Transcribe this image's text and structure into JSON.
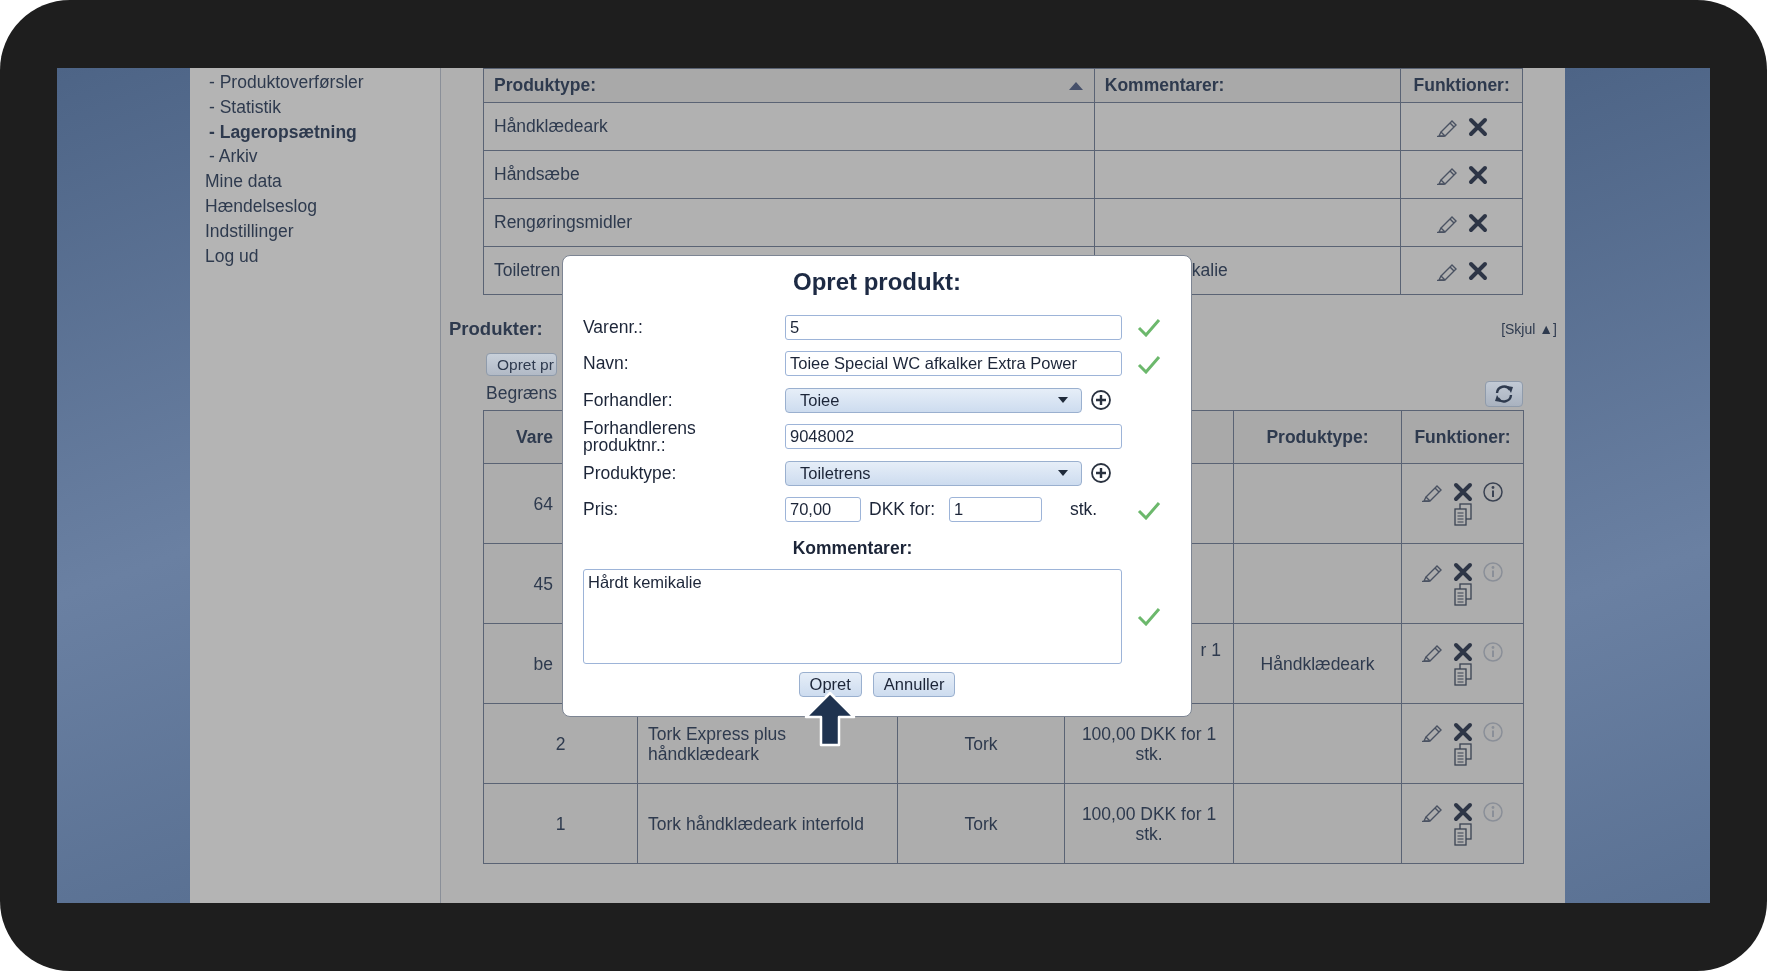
{
  "sidebar": {
    "items": [
      {
        "label": "- Produktoverførsler",
        "selected": false
      },
      {
        "label": "- Statistik",
        "selected": false
      },
      {
        "label": "- Lageropsætning",
        "selected": true
      },
      {
        "label": "- Arkiv",
        "selected": false
      },
      {
        "label": "Mine data",
        "selected": false
      },
      {
        "label": "Hændelseslog",
        "selected": false
      },
      {
        "label": "Indstillinger",
        "selected": false
      },
      {
        "label": "Log ud",
        "selected": false
      }
    ]
  },
  "product_types": {
    "columns": [
      {
        "label": "Produktype:",
        "sort_ascending": true
      },
      {
        "label": "Kommentarer:"
      },
      {
        "label": "Funktioner:"
      }
    ],
    "rows": [
      {
        "name": "Håndklædeark"
      },
      {
        "name": "Håndsæbe"
      },
      {
        "name": "Rengøringsmidler"
      },
      {
        "name": "Toiletren",
        "comment": "kalie"
      }
    ]
  },
  "products": {
    "title": "Produkter:",
    "toggle": "[Skjul ▲]",
    "create_button": "Opret pr",
    "filter_label": "Begræns",
    "column_headers": {
      "number": "Vare",
      "product_type": "Produktype:",
      "functions": "Funktioner:"
    },
    "rows": [
      {
        "number": "64",
        "info_enabled": true
      },
      {
        "number": "45",
        "info_enabled": false
      },
      {
        "number": "be",
        "price": "r 1",
        "product_type": "Håndklædeark",
        "info_enabled": false
      },
      {
        "number": "2",
        "name": "Tork Express plus håndklædeark",
        "dealer": "Tork",
        "price": "100,00 DKK for 1 stk.",
        "info_enabled": false
      },
      {
        "number": "1",
        "name": "Tork håndklædeark interfold",
        "dealer": "Tork",
        "price": "100,00 DKK for 1 stk.",
        "info_enabled": false
      }
    ]
  },
  "dialog": {
    "title": "Opret produkt:",
    "fields": [
      {
        "kind": "text",
        "label": "Varenr.:",
        "value": "5",
        "valid": true
      },
      {
        "kind": "text",
        "label": "Navn:",
        "value": "Toiee Special WC afkalker Extra Power",
        "valid": true
      },
      {
        "kind": "select",
        "label": "Forhandler:",
        "value": "Toiee"
      },
      {
        "kind": "text",
        "label": "Forhandlerens produktnr.:",
        "value": "9048002",
        "valid": false
      },
      {
        "kind": "select",
        "label": "Produktype:",
        "value": "Toiletrens"
      },
      {
        "kind": "price",
        "label": "Pris:",
        "value": "70,00",
        "currency_label": "DKK for:",
        "quantity": "1",
        "unit": "stk.",
        "valid": true
      }
    ],
    "comments": {
      "label": "Kommentarer:",
      "value": "Hårdt kemikalie",
      "valid": true
    },
    "buttons": [
      {
        "label": "Opret",
        "pointed": true
      },
      {
        "label": "Annuller",
        "pointed": false
      }
    ]
  }
}
